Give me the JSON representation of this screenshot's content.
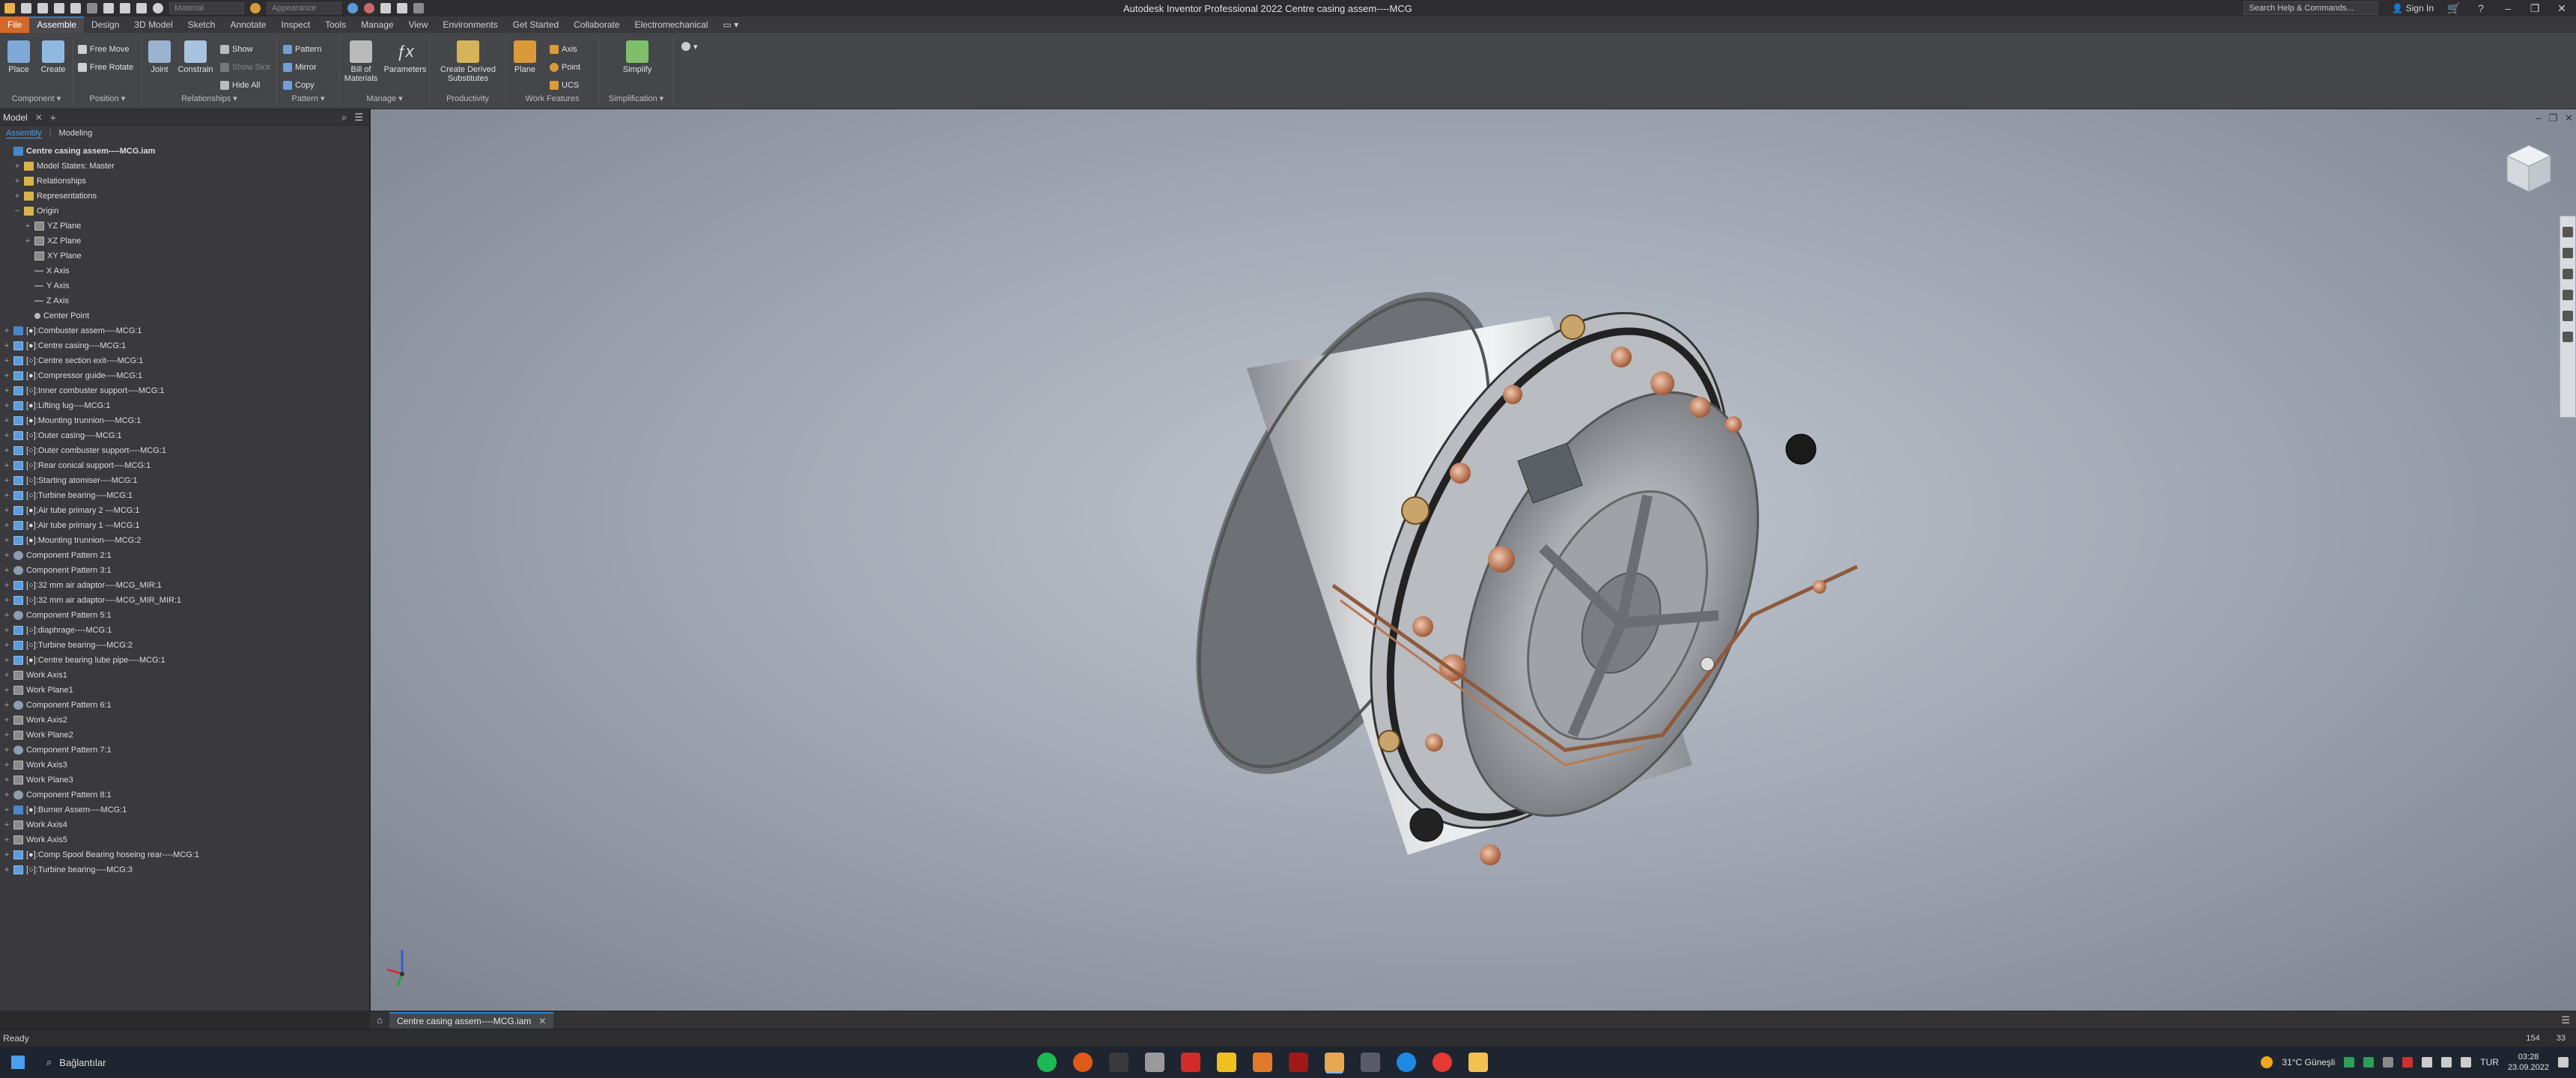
{
  "titlebar": {
    "material_value": "Material",
    "appearance_value": "Appearance",
    "title": "Autodesk Inventor Professional 2022   Centre casing assem----MCG",
    "search_placeholder": "Search Help & Commands...",
    "sign_in": "Sign In"
  },
  "ribbon_tabs": [
    "File",
    "Assemble",
    "Design",
    "3D Model",
    "Sketch",
    "Annotate",
    "Inspect",
    "Tools",
    "Manage",
    "View",
    "Environments",
    "Get Started",
    "Collaborate",
    "Electromechanical"
  ],
  "ribbon": {
    "place": "Place",
    "create": "Create",
    "free_move": "Free Move",
    "free_rotate": "Free Rotate",
    "joint": "Joint",
    "constrain": "Constrain",
    "show": "Show",
    "show_sick": "Show Sick",
    "hide_all": "Hide All",
    "pattern": "Pattern",
    "mirror": "Mirror",
    "copy": "Copy",
    "bill_of_materials_1": "Bill of",
    "bill_of_materials_2": "Materials",
    "parameters": "Parameters",
    "create_derived_1": "Create Derived",
    "create_derived_2": "Substitutes",
    "plane": "Plane",
    "axis": "Axis",
    "point": "Point",
    "ucs": "UCS",
    "simplify": "Simplify",
    "groups": {
      "component": "Component ▾",
      "position": "Position ▾",
      "relationships": "Relationships ▾",
      "pattern": "Pattern ▾",
      "manage": "Manage ▾",
      "productivity": "Productivity",
      "work_features": "Work Features",
      "simplification": "Simplification ▾"
    }
  },
  "browser": {
    "tab": "Model",
    "sub_tabs": [
      "Assembly",
      "Modeling"
    ],
    "tree": [
      {
        "label": "Centre casing assem----MCG.iam",
        "icon": "asm",
        "exp": "",
        "indent": 0,
        "root": true
      },
      {
        "label": "Model States: Master",
        "icon": "fold",
        "exp": "+",
        "indent": 1
      },
      {
        "label": "Relationships",
        "icon": "fold",
        "exp": "+",
        "indent": 1
      },
      {
        "label": "Representations",
        "icon": "fold",
        "exp": "+",
        "indent": 1
      },
      {
        "label": "Origin",
        "icon": "fold",
        "exp": "−",
        "indent": 1
      },
      {
        "label": "YZ Plane",
        "icon": "plane",
        "exp": "+",
        "indent": 2
      },
      {
        "label": "XZ Plane",
        "icon": "plane",
        "exp": "+",
        "indent": 2
      },
      {
        "label": "XY Plane",
        "icon": "plane",
        "exp": "",
        "indent": 2
      },
      {
        "label": "X Axis",
        "icon": "axis",
        "exp": "",
        "indent": 2
      },
      {
        "label": "Y Axis",
        "icon": "axis",
        "exp": "",
        "indent": 2
      },
      {
        "label": "Z Axis",
        "icon": "axis",
        "exp": "",
        "indent": 2
      },
      {
        "label": "Center Point",
        "icon": "pt",
        "exp": "",
        "indent": 2
      },
      {
        "label": "[●]:Combuster assem----MCG:1",
        "icon": "asm",
        "exp": "+",
        "indent": 0
      },
      {
        "label": "[●]:Centre casing----MCG:1",
        "icon": "part",
        "exp": "+",
        "indent": 0
      },
      {
        "label": "[○]:Centre section exit----MCG:1",
        "icon": "part",
        "exp": "+",
        "indent": 0
      },
      {
        "label": "[●]:Compressor guide----MCG:1",
        "icon": "part",
        "exp": "+",
        "indent": 0
      },
      {
        "label": "[○]:Inner combuster support----MCG:1",
        "icon": "part",
        "exp": "+",
        "indent": 0
      },
      {
        "label": "[●]:Lifting lug----MCG:1",
        "icon": "part",
        "exp": "+",
        "indent": 0
      },
      {
        "label": "[●]:Mounting trunnion----MCG:1",
        "icon": "part",
        "exp": "+",
        "indent": 0
      },
      {
        "label": "[○]:Outer casing----MCG:1",
        "icon": "part",
        "exp": "+",
        "indent": 0
      },
      {
        "label": "[○]:Outer combuster support----MCG:1",
        "icon": "part",
        "exp": "+",
        "indent": 0
      },
      {
        "label": "[○]:Rear conical support----MCG:1",
        "icon": "part",
        "exp": "+",
        "indent": 0
      },
      {
        "label": "[○]:Starting atomiser----MCG:1",
        "icon": "part",
        "exp": "+",
        "indent": 0
      },
      {
        "label": "[○]:Turbine bearing----MCG:1",
        "icon": "part",
        "exp": "+",
        "indent": 0
      },
      {
        "label": "[●]:Air tube primary 2 ---MCG:1",
        "icon": "part",
        "exp": "+",
        "indent": 0
      },
      {
        "label": "[●]:Air tube primary 1 ---MCG:1",
        "icon": "part",
        "exp": "+",
        "indent": 0
      },
      {
        "label": "[●]:Mounting trunnion----MCG:2",
        "icon": "part",
        "exp": "+",
        "indent": 0
      },
      {
        "label": "Component Pattern 2:1",
        "icon": "pat",
        "exp": "+",
        "indent": 0
      },
      {
        "label": "Component Pattern 3:1",
        "icon": "pat",
        "exp": "+",
        "indent": 0
      },
      {
        "label": "[○]:32 mm air adaptor----MCG_MIR:1",
        "icon": "part",
        "exp": "+",
        "indent": 0
      },
      {
        "label": "[○]:32 mm air adaptor----MCG_MIR_MIR:1",
        "icon": "part",
        "exp": "+",
        "indent": 0
      },
      {
        "label": "Component Pattern 5:1",
        "icon": "pat",
        "exp": "+",
        "indent": 0
      },
      {
        "label": "[○]:diaphrage----MCG:1",
        "icon": "part",
        "exp": "+",
        "indent": 0
      },
      {
        "label": "[○]:Turbine bearing----MCG:2",
        "icon": "part",
        "exp": "+",
        "indent": 0
      },
      {
        "label": "[●]:Centre bearing lube pipe----MCG:1",
        "icon": "part",
        "exp": "+",
        "indent": 0
      },
      {
        "label": "Work Axis1",
        "icon": "plane",
        "exp": "+",
        "indent": 0
      },
      {
        "label": "Work Plane1",
        "icon": "plane",
        "exp": "+",
        "indent": 0
      },
      {
        "label": "Component Pattern 6:1",
        "icon": "pat",
        "exp": "+",
        "indent": 0
      },
      {
        "label": "Work Axis2",
        "icon": "plane",
        "exp": "+",
        "indent": 0
      },
      {
        "label": "Work Plane2",
        "icon": "plane",
        "exp": "+",
        "indent": 0
      },
      {
        "label": "Component Pattern 7:1",
        "icon": "pat",
        "exp": "+",
        "indent": 0
      },
      {
        "label": "Work Axis3",
        "icon": "plane",
        "exp": "+",
        "indent": 0
      },
      {
        "label": "Work Plane3",
        "icon": "plane",
        "exp": "+",
        "indent": 0
      },
      {
        "label": "Component Pattern 8:1",
        "icon": "pat",
        "exp": "+",
        "indent": 0
      },
      {
        "label": "[●]:Burner Assem----MCG:1",
        "icon": "asm",
        "exp": "+",
        "indent": 0
      },
      {
        "label": "Work Axis4",
        "icon": "plane",
        "exp": "+",
        "indent": 0
      },
      {
        "label": "Work Axis5",
        "icon": "plane",
        "exp": "+",
        "indent": 0
      },
      {
        "label": "[●]:Comp Spool Bearing hoseing rear----MCG:1",
        "icon": "part",
        "exp": "+",
        "indent": 0
      },
      {
        "label": "[○]:Turbine bearing----MCG:3",
        "icon": "part",
        "exp": "+",
        "indent": 0
      }
    ]
  },
  "doc_tab": {
    "label": "Centre casing assem----MCG.iam"
  },
  "status": {
    "text": "Ready",
    "num1": "154",
    "num2": "33"
  },
  "taskbar": {
    "search_text": "Bağlantılar",
    "weather": "31°C  Güneşli",
    "lang": "TUR",
    "time": "03:28",
    "date": "23.09.2022"
  },
  "colors": {
    "accent": "#2b7fd3",
    "file_tab": "#d2692a"
  }
}
